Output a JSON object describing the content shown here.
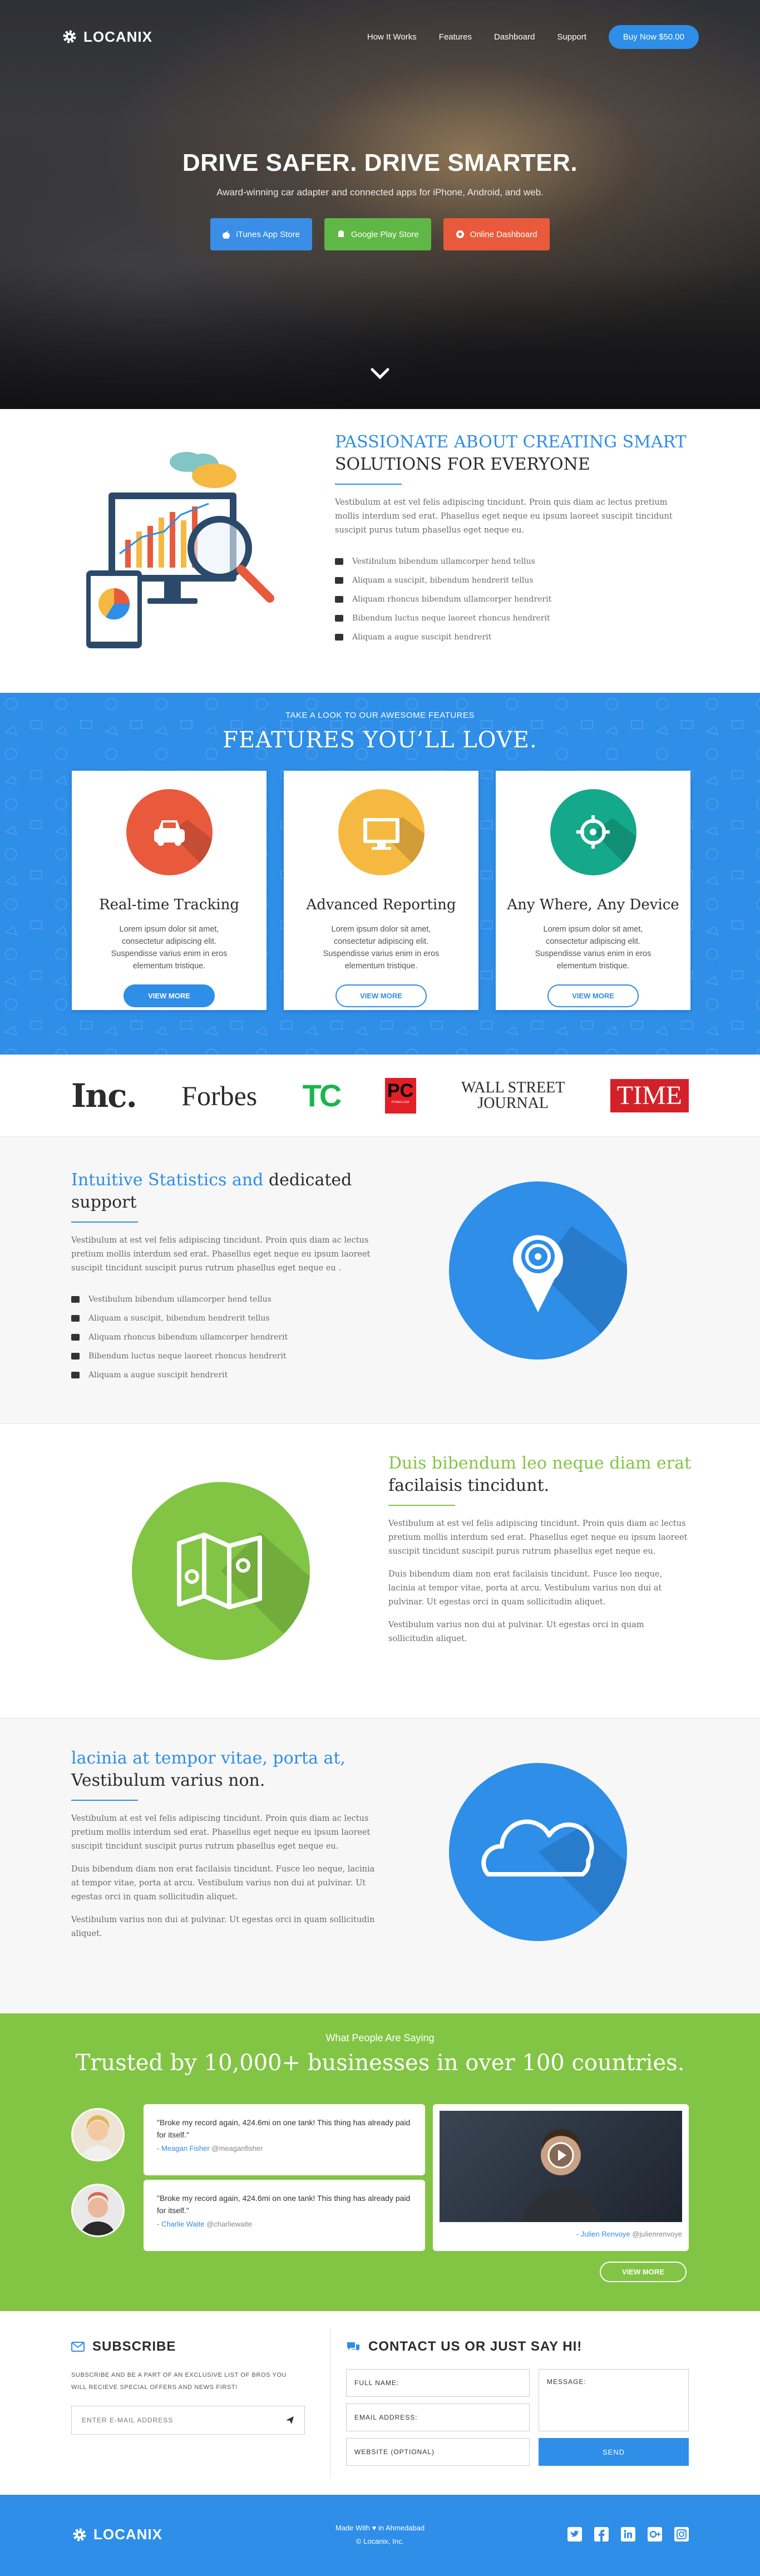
{
  "nav": {
    "brand": "LOCANIX",
    "links": [
      "How It Works",
      "Features",
      "Dashboard",
      "Support"
    ],
    "buy": "Buy Now $50.00"
  },
  "hero": {
    "title": "DRIVE SAFER. DRIVE SMARTER.",
    "subtitle": "Award-winning car adapter and connected apps for iPhone, Android, and web.",
    "buttons": [
      "iTunes App Store",
      "Google Play Store",
      "Online Dashboard"
    ]
  },
  "intro": {
    "title_blue": "PASSIONATE ABOUT CREATING SMART",
    "title_dark": "SOLUTIONS FOR EVERYONE",
    "para": "Vestibulum at est vel felis adipiscing tincidunt. Proin quis diam ac lectus pretium mollis interdum sed erat. Phasellus eget neque eu ipsum laoreet suscipit tincidunt suscipit purus tutum phasellus eget neque eu.",
    "list": [
      "Vestibulum bibendum ullamcorper hend tellus",
      "Aliquam a suscipit, bibendum hendrerit tellus",
      "Aliquam rhoncus bibendum ullamcorper hendrerit",
      "Bibendum luctus neque laoreet rhoncus hendrerit",
      "Aliquam a augue suscipit hendrerit"
    ]
  },
  "features": {
    "sub": "TAKE A LOOK TO OUR AWESOME FEATURES",
    "title": "FEATURES YOU’LL LOVE.",
    "cards": [
      {
        "title": "Real-time Tracking",
        "text": "Lorem ipsum dolor sit amet, consectetur adipiscing elit. Suspendisse varius enim in eros elementum tristique.",
        "btn": "VIEW MORE"
      },
      {
        "title": "Advanced Reporting",
        "text": "Lorem ipsum dolor sit amet, consectetur adipiscing elit. Suspendisse varius enim in eros elementum tristique.",
        "btn": "VIEW MORE"
      },
      {
        "title": "Any Where, Any Device",
        "text": "Lorem ipsum dolor sit amet, consectetur adipiscing elit. Suspendisse varius enim in eros elementum tristique.",
        "btn": "VIEW MORE"
      }
    ]
  },
  "press": [
    "Inc.",
    "Forbes",
    "TC",
    "PC",
    "WALL STREET",
    "JOURNAL",
    "TIME",
    "PCMAG.COM"
  ],
  "stats": {
    "title_blue": "Intuitive Statistics and",
    "title_dark1": "dedicated",
    "title_dark2": "support",
    "para": "Vestibulum at est vel felis adipiscing tincidunt. Proin quis diam ac lectus pretium mollis interdum sed erat. Phasellus eget neque eu ipsum laoreet suscipit tincidunt suscipit purus rutrum phasellus eget neque eu .",
    "list": [
      "Vestibulum bibendum ullamcorper hend tellus",
      "Aliquam a suscipit, bibendum hendrerit tellus",
      "Aliquam rhoncus bibendum ullamcorper hendrerit",
      "Bibendum luctus neque laoreet rhoncus hendrerit",
      "Aliquam a augue suscipit hendrerit"
    ]
  },
  "maps": {
    "title_green": "Duis bibendum leo neque diam erat",
    "title_dark": "facilaisis tincidunt.",
    "para1": "Vestibulum at est vel felis adipiscing tincidunt. Proin quis diam ac lectus pretium mollis interdum sed erat. Phasellus eget neque eu ipsum laoreet suscipit tincidunt suscipit purus rutrum phasellus eget neque eu.",
    "para2": "Duis bibendum diam non erat facilaisis tincidunt. Fusce leo neque, lacinia at tempor vitae, porta at arcu. Vestibulum varius non dui at pulvinar. Ut egestas orci in quam sollicitudin aliquet.",
    "para3": "Vestibulum varius non dui at pulvinar. Ut egestas orci in quam sollicitudin aliquet."
  },
  "cloud": {
    "title_blue": "lacinia at tempor vitae, porta at,",
    "title_dark": "Vestibulum varius non.",
    "para1": "Vestibulum at est vel felis adipiscing tincidunt. Proin quis diam ac lectus pretium mollis interdum sed erat. Phasellus eget neque eu ipsum laoreet suscipit tincidunt suscipit purus rutrum phasellus eget neque eu.",
    "para2": "Duis bibendum diam non erat facilaisis tincidunt. Fusce leo neque, lacinia at tempor vitae, porta at arcu. Vestibulum varius non dui at pulvinar. Ut egestas orci in quam sollicitudin aliquet.",
    "para3": "Vestibulum varius non dui at pulvinar. Ut egestas orci in quam sollicitudin aliquet."
  },
  "testimonials": {
    "sub": "What People Are Saying",
    "title": "Trusted by 10,000+ businesses in over 100 countries.",
    "q1": "\"Broke my record again, 424.6mi on one tank! This thing has already paid for itself.\"",
    "q1_name": "- Meagan Fisher",
    "q1_handle": "@meaganfisher",
    "q2": "\"Broke my record again, 424.6mi on one tank! This thing has already paid for itself.\"",
    "q2_name": "- Charlie Waite",
    "q2_handle": "@charliewaite",
    "video_name": "- Julien Renvoye",
    "video_handle": "@julienrenvoye",
    "more": "VIEW MORE"
  },
  "subscribe": {
    "title": "SUBSCRIBE",
    "text": "SUBSCRIBE AND BE A PART OF AN EXCLUSIVE LIST OF BROS YOU WILL RECIEVE SPECIAL OFFERS AND NEWS FIRST!",
    "placeholder": "ENTER E-MAIL ADDRESS"
  },
  "contact": {
    "title": "CONTACT US OR JUST SAY HI!",
    "name": "FULL NAME:",
    "email": "EMAIL ADDRESS:",
    "website": "WEBSITE (OPTIONAL)",
    "message": "MESSAGE:",
    "send": "SEND"
  },
  "footer": {
    "brand": "LOCANIX",
    "made_a": "Made With",
    "made_b": "in Ahmedabad",
    "copy": "© Locanix, Inc."
  },
  "colors": {
    "blue": "#2e8ee8",
    "green": "#82c545",
    "red": "#e95a3d",
    "yellow": "#f5b942",
    "teal": "#14a98a"
  }
}
